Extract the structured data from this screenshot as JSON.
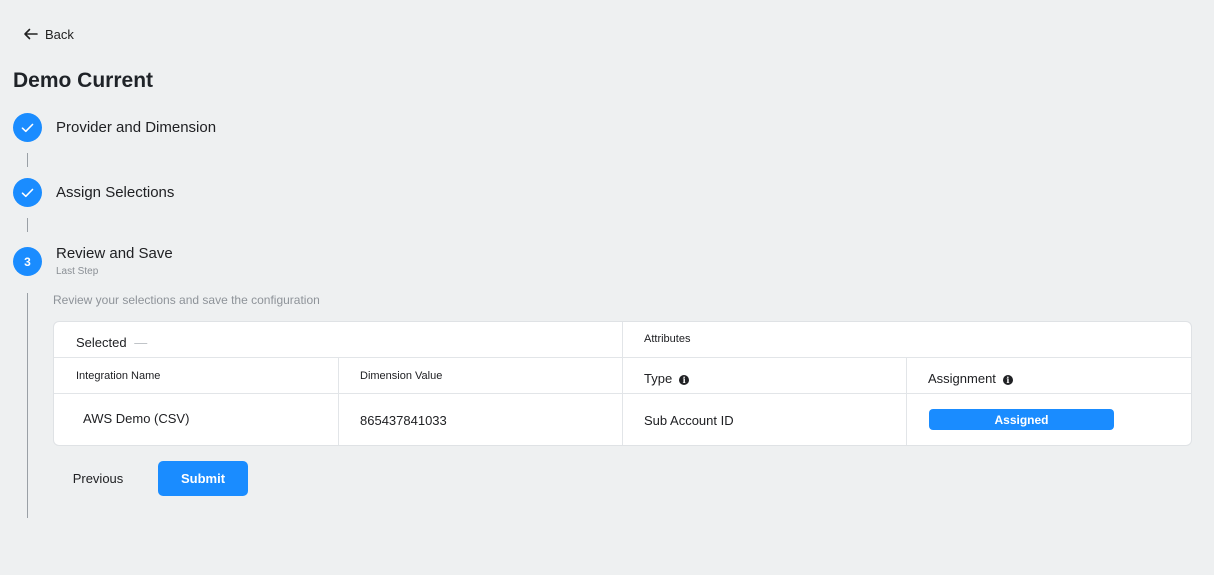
{
  "nav": {
    "back_label": "Back"
  },
  "page": {
    "title": "Demo Current"
  },
  "steps": [
    {
      "marker": "✓",
      "label": "Provider and Dimension",
      "status": "done"
    },
    {
      "marker": "✓",
      "label": "Assign Selections",
      "status": "done"
    },
    {
      "marker": "3",
      "label": "Review and Save",
      "sublabel": "Last Step",
      "status": "current"
    }
  ],
  "review": {
    "description": "Review your selections and save the configuration",
    "table": {
      "group_headers": {
        "selected": "Selected",
        "selected_suffix": "—",
        "attributes": "Attributes"
      },
      "columns": [
        "Integration Name",
        "Dimension Value",
        "Type",
        "Assignment"
      ],
      "rows": [
        {
          "integration_name": "AWS Demo (CSV)",
          "dimension_value": "865437841033",
          "type": "Sub Account ID",
          "assignment": "Assigned"
        }
      ]
    }
  },
  "actions": {
    "previous_label": "Previous",
    "submit_label": "Submit"
  },
  "colors": {
    "accent": "#1a8cff",
    "background": "#eef0f1"
  }
}
